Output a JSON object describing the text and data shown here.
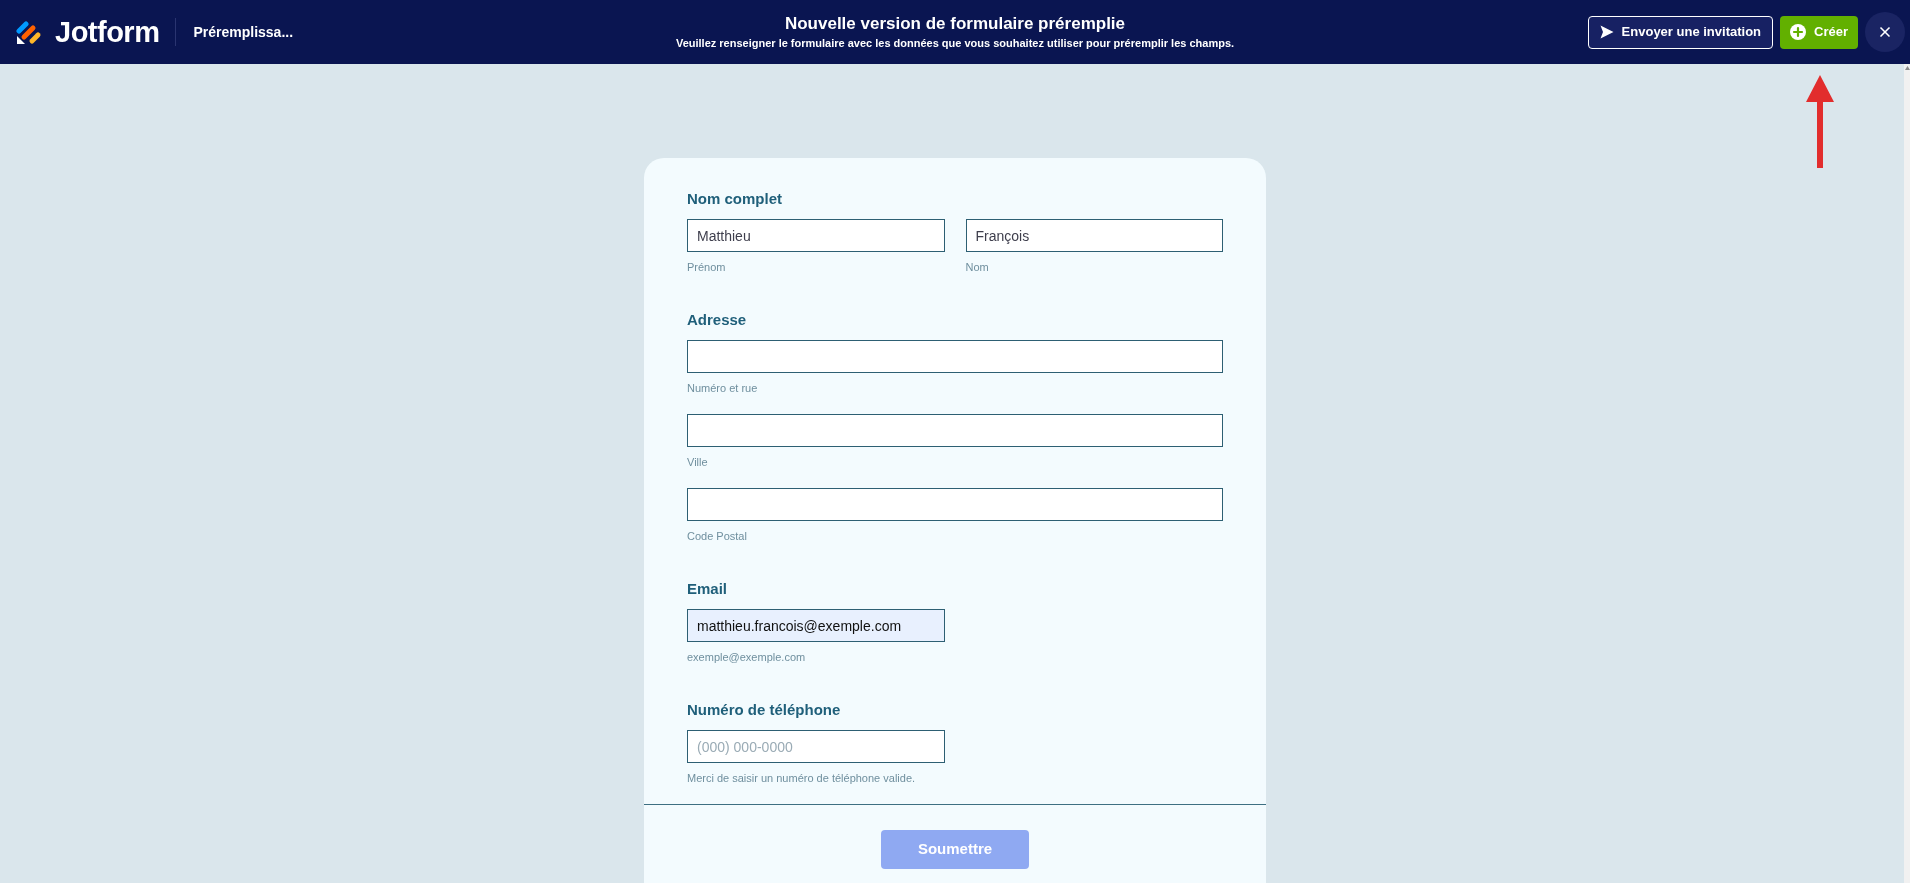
{
  "header": {
    "brand": "Jotform",
    "form_name": "Préremplissa...",
    "title": "Nouvelle version de formulaire préremplie",
    "subtitle": "Veuillez renseigner le formulaire avec les données que vous souhaitez utiliser pour préremplir les champs.",
    "buttons": [
      {
        "kind": "outline",
        "label": "Envoyer une invitation"
      },
      {
        "kind": "primary",
        "label": "Créer"
      }
    ]
  },
  "form": {
    "sections": [
      {
        "kind": "split",
        "label": "Nom complet",
        "inputs": [
          {
            "value": "Matthieu",
            "sublabel": "Prénom",
            "autofilled": false
          },
          {
            "value": "François",
            "sublabel": "Nom",
            "autofilled": false
          }
        ]
      },
      {
        "kind": "stack",
        "label": "Adresse",
        "inputs": [
          {
            "sublabel": "Numéro et rue",
            "autofilled": false
          },
          {
            "sublabel": "Ville",
            "autofilled": false
          },
          {
            "sublabel": "Code Postal",
            "autofilled": false
          }
        ]
      },
      {
        "kind": "short",
        "label": "Email",
        "inputs": [
          {
            "value": "matthieu.francois@exemple.com",
            "sublabel": "exemple@exemple.com",
            "autofilled": true
          }
        ]
      },
      {
        "kind": "short",
        "label": "Numéro de téléphone",
        "inputs": [
          {
            "placeholder": "(000) 000-0000",
            "sublabel": "Merci de saisir un numéro de téléphone valide.",
            "autofilled": false
          }
        ]
      }
    ],
    "submit": {
      "label": "Soumettre",
      "disabled": true
    }
  }
}
